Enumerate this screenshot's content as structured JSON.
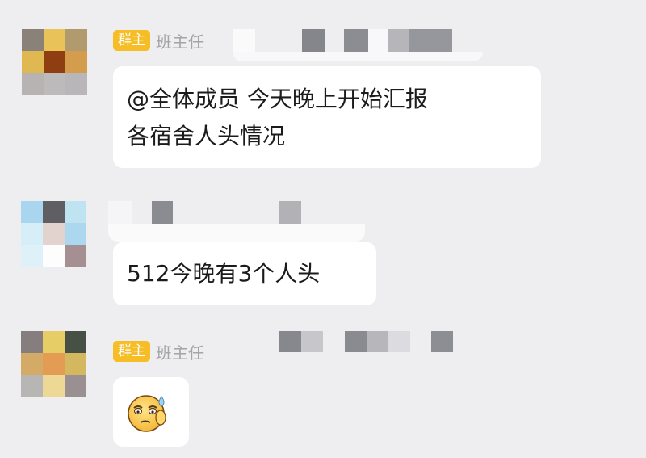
{
  "colors": {
    "background": "#eeeef1",
    "badge": "#f6bd26",
    "bubble": "#ffffff",
    "sender_name": "#a3a3a8"
  },
  "messages": [
    {
      "badge": "群主",
      "sender": "班主任",
      "lines": [
        "@全体成员 今天晚上开始汇报",
        "各宿舍人头情况"
      ]
    },
    {
      "lines": [
        "512今晚有3个人头"
      ]
    },
    {
      "badge": "群主",
      "sender": "班主任",
      "sticker": "sweating-face-emoji-icon"
    }
  ]
}
